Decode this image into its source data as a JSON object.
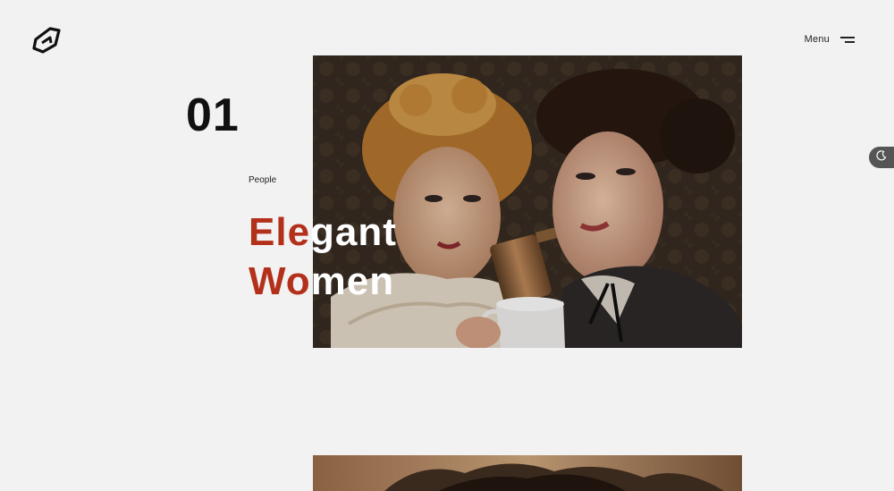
{
  "header": {
    "menu_label": "Menu"
  },
  "slide": {
    "number": "01",
    "category": "People",
    "title_line1_left": "Ele",
    "title_line1_right": "gant",
    "title_line2_left": "Wo",
    "title_line2_right": "men"
  },
  "icons": {
    "logo": "brand-logo-icon",
    "menu": "hamburger-icon",
    "theme": "moon-icon"
  },
  "colors": {
    "background": "#f2f2f2",
    "accent": "#b3301b",
    "toggle": "#555555"
  }
}
